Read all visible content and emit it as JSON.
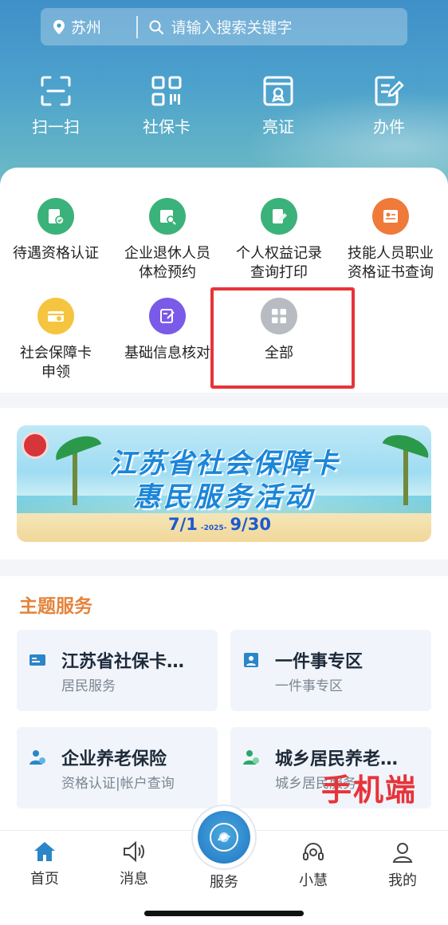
{
  "search": {
    "city": "苏州",
    "placeholder": "请输入搜索关键字"
  },
  "quick_actions": [
    {
      "label": "扫一扫",
      "icon": "scan-icon"
    },
    {
      "label": "社保卡",
      "icon": "qr-code-icon"
    },
    {
      "label": "亮证",
      "icon": "certificate-icon"
    },
    {
      "label": "办件",
      "icon": "edit-document-icon"
    }
  ],
  "services": [
    {
      "label": "待遇资格认证",
      "icon": "id-check-icon",
      "color": "#3bb27a"
    },
    {
      "label": "企业退休人员\n体检预约",
      "icon": "search-card-icon",
      "color": "#3bb27a"
    },
    {
      "label": "个人权益记录\n查询打印",
      "icon": "document-pen-icon",
      "color": "#3bb27a"
    },
    {
      "label": "技能人员职业\n资格证书查询",
      "icon": "certificate-card-icon",
      "color": "#ef7a3a"
    },
    {
      "label": "社会保障卡\n申领",
      "icon": "card-check-icon",
      "color": "#f5c53f"
    },
    {
      "label": "基础信息核对",
      "icon": "note-edit-icon",
      "color": "#7a5ae8"
    },
    {
      "label": "全部",
      "icon": "grid-icon",
      "color": "#b8bcc2"
    }
  ],
  "banner": {
    "title_line1": "江苏省社会保障卡",
    "title_line2": "惠民服务活动",
    "date_start": "7/1",
    "date_year": "-2025-",
    "date_end": "9/30"
  },
  "theme": {
    "heading": "主题服务",
    "cards": [
      {
        "title": "江苏省社保卡…",
        "subtitle": "居民服务",
        "icon": "card-icon"
      },
      {
        "title": "一件事专区",
        "subtitle": "一件事专区",
        "icon": "person-badge-icon"
      },
      {
        "title": "企业养老保险",
        "subtitle": "资格认证|帐户查询",
        "icon": "elder-icon"
      },
      {
        "title": "城乡居民养老…",
        "subtitle": "城乡居民服务",
        "icon": "elder-green-icon"
      }
    ]
  },
  "watermark": "手机端",
  "tabs": [
    {
      "label": "首页",
      "icon": "home-icon"
    },
    {
      "label": "消息",
      "icon": "speaker-icon"
    },
    {
      "label": "服务",
      "icon": "service-logo-icon"
    },
    {
      "label": "小慧",
      "icon": "headset-icon"
    },
    {
      "label": "我的",
      "icon": "user-icon"
    }
  ],
  "colors": {
    "accent": "#3f8fc9",
    "theme_heading": "#e5833b",
    "highlight": "#e6343a",
    "tab_active": "#2a86c9"
  }
}
